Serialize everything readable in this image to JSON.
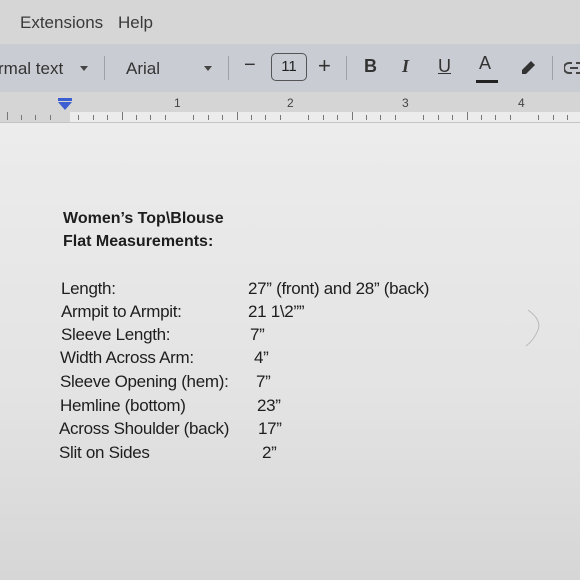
{
  "menubar": {
    "items": [
      "Extensions",
      "Help"
    ]
  },
  "toolbar": {
    "style_value": "rmal text",
    "font_value": "Arial",
    "decrease_symbol": "−",
    "font_size": "11",
    "increase_symbol": "+",
    "bold": "B",
    "italic": "I",
    "underline": "U",
    "text_color": "A",
    "icons": [
      "chevron-down-icon",
      "highlighter-icon",
      "link-icon"
    ]
  },
  "ruler": {
    "numbers": [
      "1",
      "2",
      "3",
      "4"
    ]
  },
  "document": {
    "title_line1": "Women’s Top\\Blouse",
    "title_line2": "Flat Measurements:",
    "measurements": [
      {
        "label": "Length:",
        "value": "27” (front) and 28” (back)"
      },
      {
        "label": "Armpit to Armpit:",
        "value": "21 1\\2””"
      },
      {
        "label": "Sleeve Length:",
        "value": "7”"
      },
      {
        "label": "Width Across Arm:",
        "value": "4”"
      },
      {
        "label": "Sleeve Opening (hem):",
        "value": "7”"
      },
      {
        "label": "Hemline (bottom)",
        "value": "23”"
      },
      {
        "label": "Across Shoulder (back)",
        "value": "17”"
      },
      {
        "label": "Slit on Sides",
        "value": "2”"
      }
    ]
  }
}
